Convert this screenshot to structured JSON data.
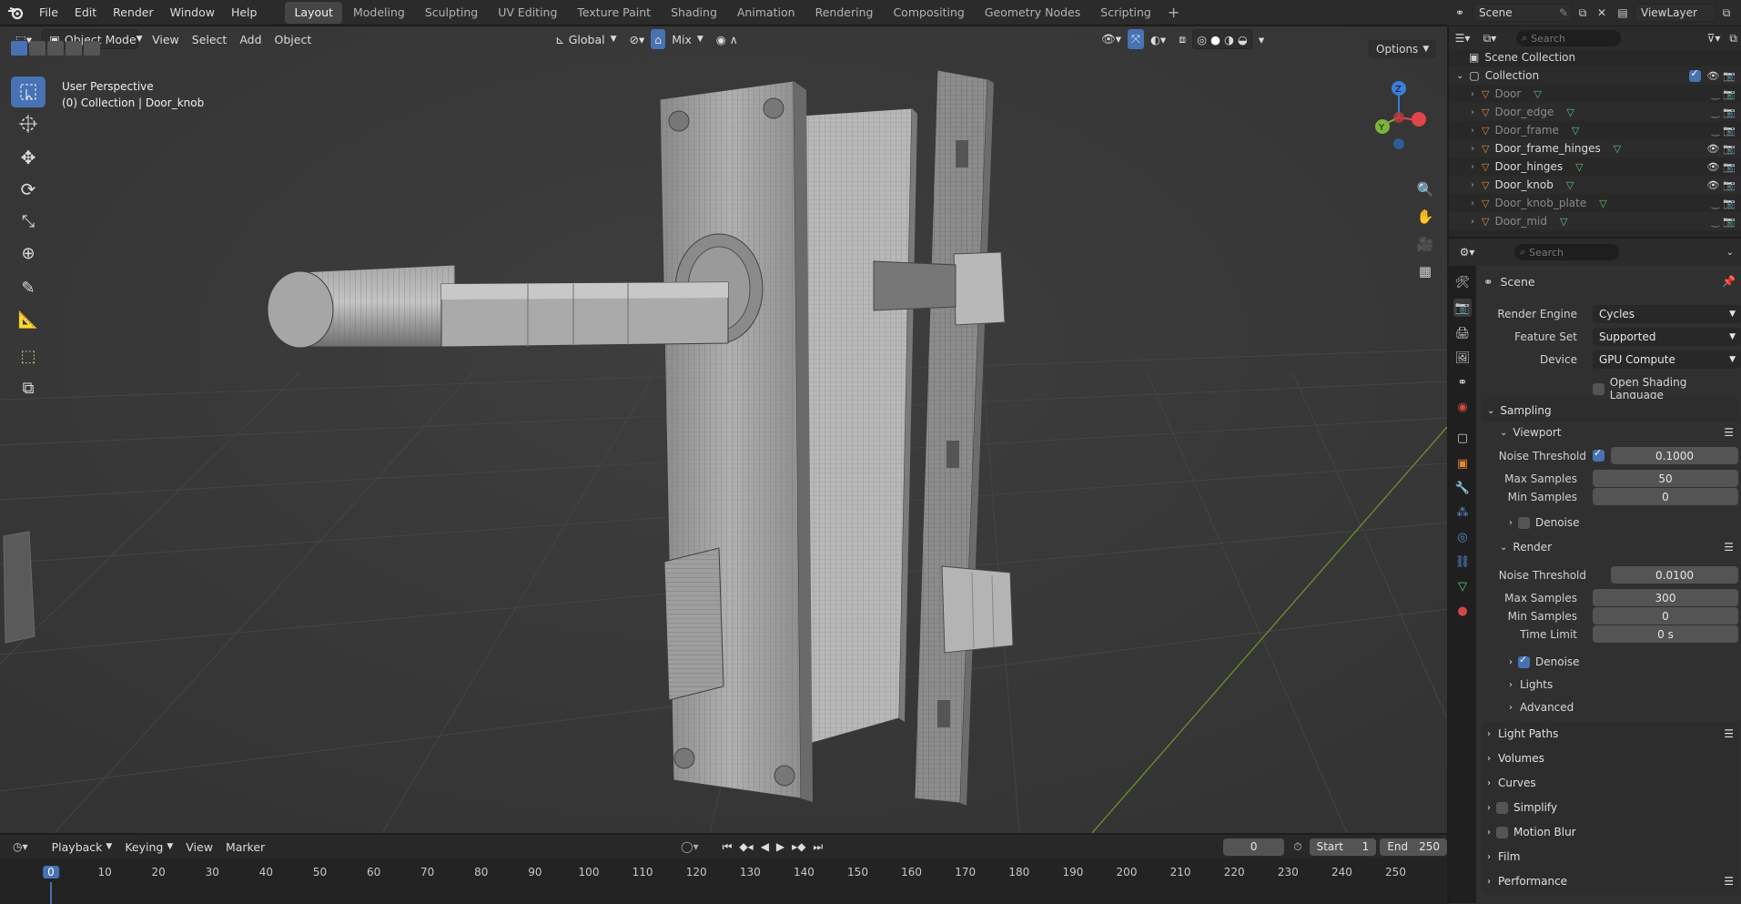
{
  "menu": {
    "items": [
      "File",
      "Edit",
      "Render",
      "Window",
      "Help"
    ]
  },
  "workspaces": {
    "tabs": [
      "Layout",
      "Modeling",
      "Sculpting",
      "UV Editing",
      "Texture Paint",
      "Shading",
      "Animation",
      "Rendering",
      "Compositing",
      "Geometry Nodes",
      "Scripting"
    ],
    "active": "Layout",
    "add_label": "+"
  },
  "scene": {
    "name": "Scene",
    "view_layer": "ViewLayer"
  },
  "viewport_header": {
    "mode": "Object Mode",
    "view": "View",
    "select": "Select",
    "add": "Add",
    "object": "Object",
    "orientation": "Global",
    "snap_mix": "Mix",
    "options": "Options"
  },
  "viewport": {
    "perspective_label": "User Perspective",
    "collection_label": "(0) Collection | Door_knob",
    "gizmo_axes": {
      "x": "X",
      "y": "Y",
      "z": "Z"
    }
  },
  "outliner": {
    "search_placeholder": "Search",
    "root": "Scene Collection",
    "collection": "Collection",
    "objects": [
      {
        "name": "Door",
        "visible": false
      },
      {
        "name": "Door_edge",
        "visible": false
      },
      {
        "name": "Door_frame",
        "visible": false
      },
      {
        "name": "Door_frame_hinges",
        "visible": true
      },
      {
        "name": "Door_hinges",
        "visible": true
      },
      {
        "name": "Door_knob",
        "visible": true
      },
      {
        "name": "Door_knob_plate",
        "visible": false
      },
      {
        "name": "Door_mid",
        "visible": false
      }
    ]
  },
  "properties": {
    "search_placeholder": "Search",
    "context": "Scene",
    "render_engine_label": "Render Engine",
    "render_engine": "Cycles",
    "feature_set_label": "Feature Set",
    "feature_set": "Supported",
    "device_label": "Device",
    "device": "GPU Compute",
    "osl_label": "Open Shading Language",
    "sampling": "Sampling",
    "viewport": {
      "title": "Viewport",
      "noise_threshold_label": "Noise Threshold",
      "noise_threshold": "0.1000",
      "max_samples_label": "Max Samples",
      "max_samples": "50",
      "min_samples_label": "Min Samples",
      "min_samples": "0",
      "denoise": "Denoise"
    },
    "render": {
      "title": "Render",
      "noise_threshold_label": "Noise Threshold",
      "noise_threshold": "0.0100",
      "max_samples_label": "Max Samples",
      "max_samples": "300",
      "min_samples_label": "Min Samples",
      "min_samples": "0",
      "time_limit_label": "Time Limit",
      "time_limit": "0 s",
      "denoise": "Denoise"
    },
    "lights": "Lights",
    "advanced": "Advanced",
    "sections": [
      "Light Paths",
      "Volumes",
      "Curves",
      "Simplify",
      "Motion Blur",
      "Film",
      "Performance"
    ]
  },
  "timeline": {
    "playback": "Playback",
    "keying": "Keying",
    "view": "View",
    "marker": "Marker",
    "current_frame": "0",
    "start_label": "Start",
    "start": "1",
    "end_label": "End",
    "end": "250",
    "ticks": [
      "0",
      "10",
      "20",
      "30",
      "40",
      "50",
      "60",
      "70",
      "80",
      "90",
      "100",
      "110",
      "120",
      "130",
      "140",
      "150",
      "160",
      "170",
      "180",
      "190",
      "200",
      "210",
      "220",
      "230",
      "240",
      "250"
    ]
  },
  "colors": {
    "accent": "#4772b3",
    "selected_row": "#334d80",
    "x_axis": "#e0454c",
    "y_axis": "#7bb33a",
    "z_axis": "#3a7fd9"
  }
}
